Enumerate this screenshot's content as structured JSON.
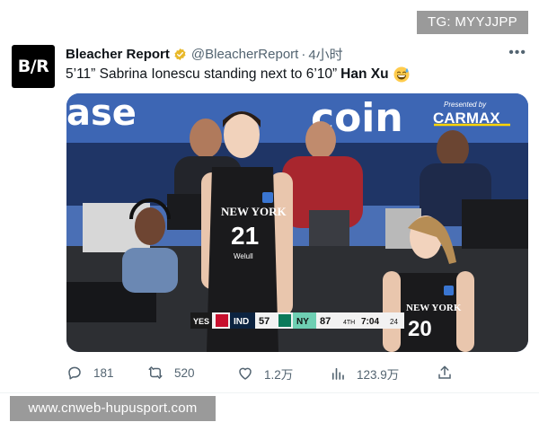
{
  "watermarks": {
    "top": "TG: MYYJJPP",
    "bottom": "www.cnweb-hupusport.com"
  },
  "tweet": {
    "avatar_text": "B/R",
    "display_name": "Bleacher Report",
    "handle": "@BleacherReport",
    "separator": "·",
    "time": "4小时",
    "text_main": "5’11” Sabrina Ionescu standing next to 6’10”",
    "text_bold": "Han Xu",
    "emoji": "grinning-sweat-emoji"
  },
  "media": {
    "banner_left": "ase",
    "banner_right": "coin",
    "presented_by": "Presented by",
    "sponsor": "CARMAX",
    "jersey_team_1": "NEW YORK",
    "jersey_number_1": "21",
    "jersey_sponsor": "Welull",
    "jersey_team_2": "NEW YORK",
    "jersey_number_2": "20",
    "scoreboard": {
      "network": "YES",
      "away_abbr": "IND",
      "away_score": "57",
      "home_abbr": "NY",
      "home_score": "87",
      "quarter": "4TH",
      "clock": "7:04",
      "shot_clock": "24"
    }
  },
  "actions": {
    "replies": "181",
    "retweets": "520",
    "likes": "1.2万",
    "views": "123.9万"
  },
  "colors": {
    "text": "#0f1419",
    "secondary": "#536471",
    "verified_gold": "#e8b829",
    "banner_blue": "#4a6fb5",
    "watermark_gray": "#9a9a9a"
  }
}
